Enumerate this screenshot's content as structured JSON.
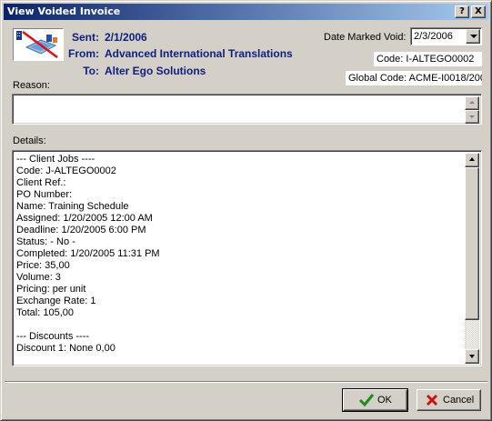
{
  "window": {
    "title": "View Voided Invoice",
    "help_button": "?",
    "close_button": "X"
  },
  "header": {
    "sent_label": "Sent:",
    "sent_value": "2/1/2006",
    "from_label": "From:",
    "from_value": "Advanced International Translations",
    "to_label": "To:",
    "to_value": "Alter Ego Solutions"
  },
  "date_marked_void": {
    "label": "Date Marked Void:",
    "value": "2/3/2006"
  },
  "code": "Code: I-ALTEGO0002",
  "global_code": "Global Code: ACME-I0018/200",
  "reason": {
    "label": "Reason:",
    "value": ""
  },
  "details": {
    "label": "Details:",
    "lines": [
      "--- Client Jobs ----",
      "Code: J-ALTEGO0002",
      "Client Ref.:",
      "PO Number:",
      "Name: Training Schedule",
      "Assigned: 1/20/2005 12:00 AM",
      "Deadline: 1/20/2005 6:00 PM",
      "Status: - No -",
      "Completed: 1/20/2005 11:31 PM",
      "Price: 35,00",
      "Volume: 3",
      "Pricing: per unit",
      "Exchange Rate: 1",
      "Total: 105,00",
      "",
      "--- Discounts ----",
      "Discount 1: None 0,00"
    ]
  },
  "buttons": {
    "ok": "OK",
    "cancel": "Cancel"
  },
  "colors": {
    "title_bar": "#0a246a",
    "header_text": "#0c1e80",
    "ok_check": "#1a8f1a",
    "cancel_x": "#cc1111"
  }
}
